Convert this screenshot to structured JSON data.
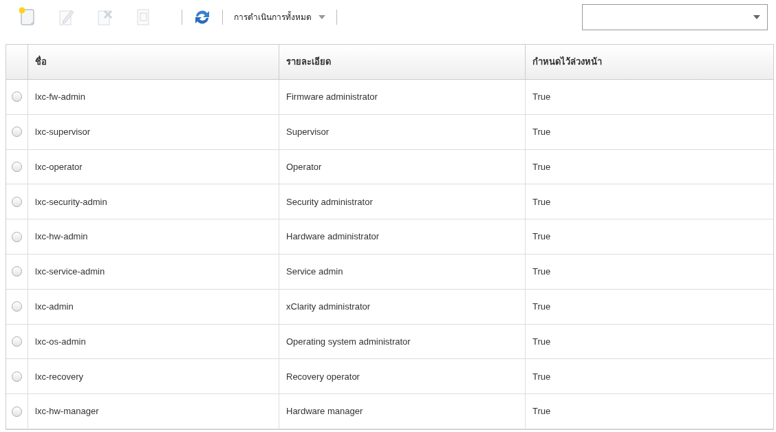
{
  "toolbar": {
    "buttons": [
      {
        "kind": "create",
        "disabled": false
      },
      {
        "kind": "edit",
        "disabled": true
      },
      {
        "kind": "delete",
        "disabled": true
      },
      {
        "kind": "copy",
        "disabled": true
      },
      {
        "kind": "refresh",
        "disabled": false
      }
    ],
    "actions_menu": {
      "label": "การดำเนินการทั้งหมด"
    }
  },
  "table": {
    "columns": [
      "ชื่อ",
      "รายละเอียด",
      "กำหนดไว้ล่วงหน้า"
    ],
    "rows": [
      {
        "selected": false,
        "cells": [
          "lxc-fw-admin",
          "Firmware administrator",
          "True"
        ]
      },
      {
        "selected": false,
        "cells": [
          "lxc-supervisor",
          "Supervisor",
          "True"
        ]
      },
      {
        "selected": false,
        "cells": [
          "lxc-operator",
          "Operator",
          "True"
        ]
      },
      {
        "selected": false,
        "cells": [
          "lxc-security-admin",
          "Security administrator",
          "True"
        ]
      },
      {
        "selected": false,
        "cells": [
          "lxc-hw-admin",
          "Hardware administrator",
          "True"
        ]
      },
      {
        "selected": false,
        "cells": [
          "lxc-service-admin",
          "Service admin",
          "True"
        ]
      },
      {
        "selected": false,
        "cells": [
          "lxc-admin",
          "xClarity administrator",
          "True"
        ]
      },
      {
        "selected": false,
        "cells": [
          "lxc-os-admin",
          "Operating system administrator",
          "True"
        ]
      },
      {
        "selected": false,
        "cells": [
          "lxc-recovery",
          "Recovery operator",
          "True"
        ]
      },
      {
        "selected": false,
        "cells": [
          "lxc-hw-manager",
          "Hardware manager",
          "True"
        ]
      }
    ]
  }
}
